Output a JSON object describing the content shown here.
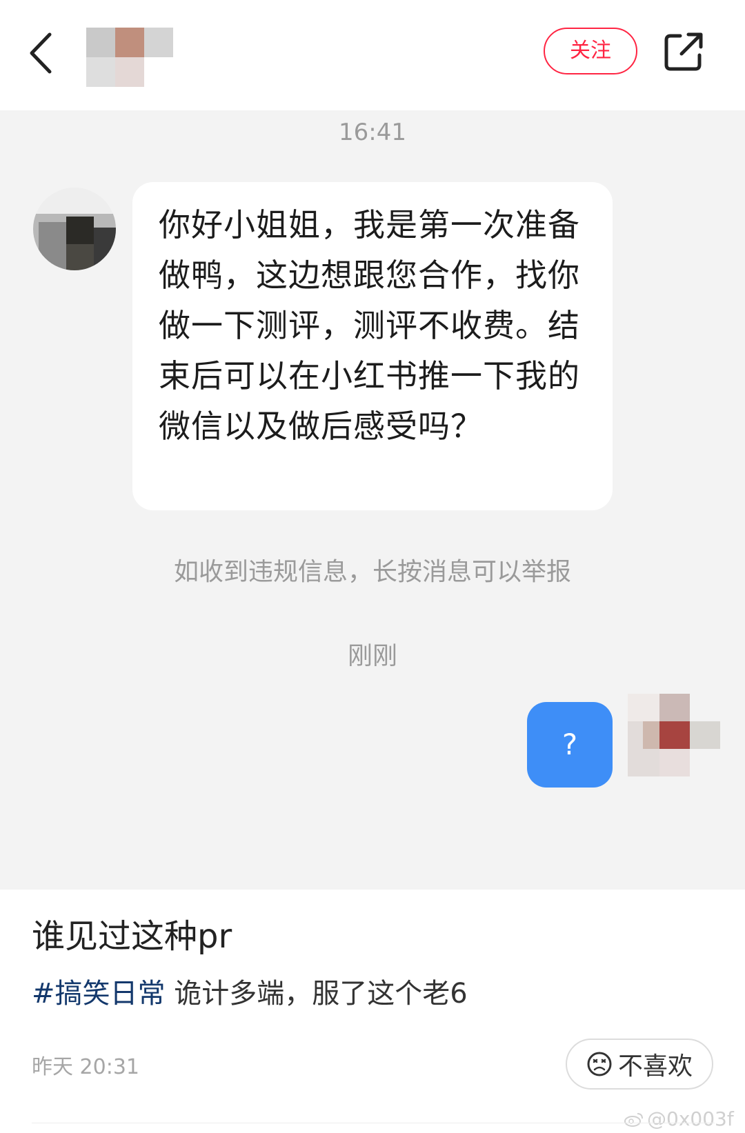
{
  "header": {
    "back_icon": "chevron-left-icon",
    "avatar": "blurred-avatar",
    "follow_label": "关注",
    "share_icon": "share-external-icon"
  },
  "chat": {
    "time_top": "16:41",
    "incoming_message": "你好小姐姐，我是第一次准备做鸭，这边想跟您合作，找你做一下测评，测评不收费。结束后可以在小红书推一下我的微信以及做后感受吗？",
    "report_notice": "如收到违规信息，长按消息可以举报",
    "time_mid": "刚刚",
    "outgoing_message": "?"
  },
  "post": {
    "title": "谁见过这种pr",
    "hashtag": "#搞笑日常",
    "desc": " 诡计多端，服了这个老6",
    "time": "昨天 20:31",
    "dislike_icon": "frown-face-icon",
    "dislike_label": "不喜欢",
    "watermark": "@0x003f"
  },
  "colors": {
    "accent": "#ff2442",
    "bubble_blue": "#3e8ef7",
    "chat_bg": "#f3f3f3",
    "hashtag": "#13386c"
  }
}
